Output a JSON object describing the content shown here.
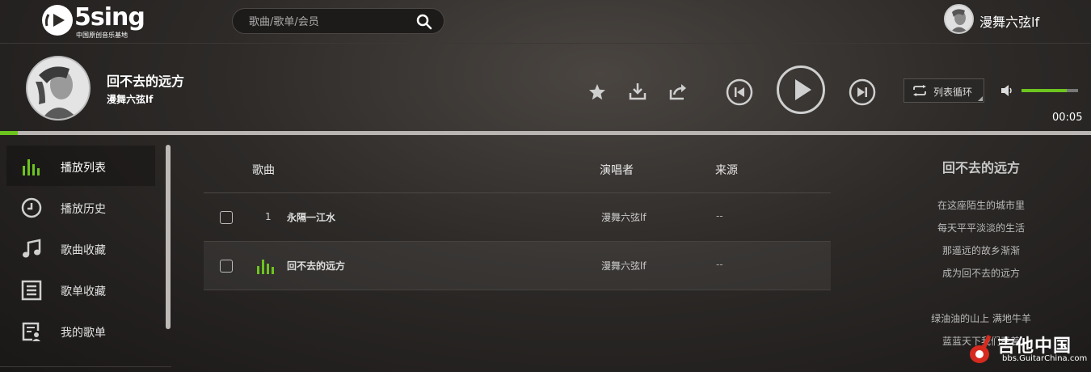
{
  "header": {
    "logo_text": "5sing",
    "logo_sub": "中国原创音乐基地",
    "search_placeholder": "歌曲/歌单/会员",
    "user_name": "漫舞六弦lf"
  },
  "player": {
    "title": "回不去的远方",
    "artist": "漫舞六弦lf",
    "loop_label": "列表循环",
    "time": "00:05",
    "progress_fraction": 0.016,
    "volume_fraction": 0.8,
    "accent_color": "#6dc41f"
  },
  "sidebar": {
    "items": [
      {
        "label": "播放列表",
        "icon": "equalizer-icon",
        "active": true
      },
      {
        "label": "播放历史",
        "icon": "clock-icon",
        "active": false
      },
      {
        "label": "歌曲收藏",
        "icon": "music-note-icon",
        "active": false
      },
      {
        "label": "歌单收藏",
        "icon": "list-icon",
        "active": false
      },
      {
        "label": "我的歌单",
        "icon": "user-list-icon",
        "active": false
      }
    ]
  },
  "table": {
    "headers": {
      "song": "歌曲",
      "artist": "演唱者",
      "source": "来源"
    },
    "rows": [
      {
        "index": "1",
        "name": "永隔一江水",
        "artist": "漫舞六弦lf",
        "source": "--",
        "playing": false
      },
      {
        "index": "",
        "name": "回不去的远方",
        "artist": "漫舞六弦lf",
        "source": "--",
        "playing": true
      }
    ]
  },
  "lyrics": {
    "title": "回不去的远方",
    "lines": [
      "在这座陌生的城市里",
      "每天平平淡淡的生活",
      "那遥远的故乡渐渐",
      "成为回不去的远方",
      "",
      "绿油油的山上 满地牛羊",
      "蓝蓝天下我们牵着"
    ]
  },
  "watermark": {
    "text": "吉他中国",
    "sub": "bbs.GuitarChina.com"
  }
}
